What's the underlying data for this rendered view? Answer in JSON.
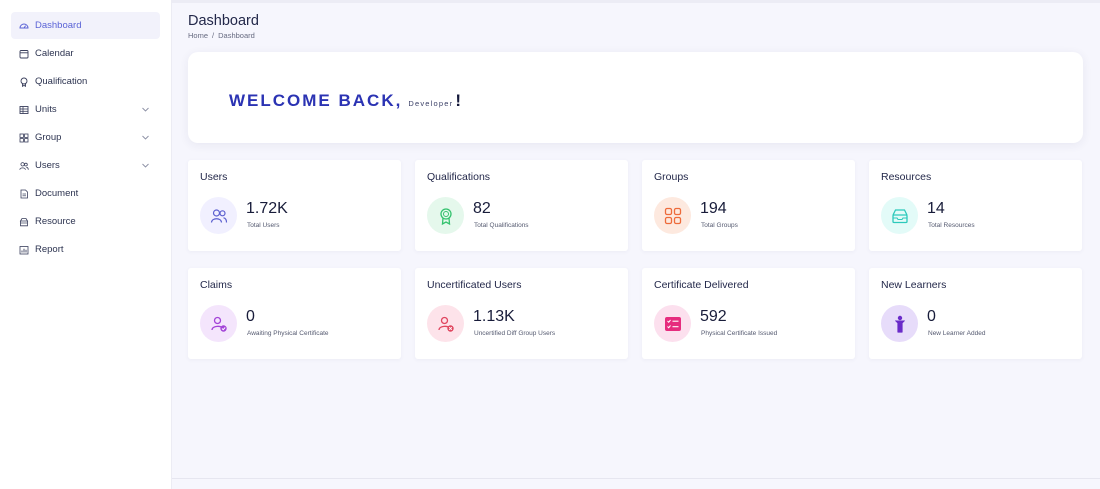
{
  "sidebar": {
    "items": [
      {
        "label": "Dashboard",
        "icon": "dashboard-icon",
        "active": true
      },
      {
        "label": "Calendar",
        "icon": "calendar-icon"
      },
      {
        "label": "Qualification",
        "icon": "qualification-icon"
      },
      {
        "label": "Units",
        "icon": "units-icon",
        "expandable": true
      },
      {
        "label": "Group",
        "icon": "group-icon",
        "expandable": true
      },
      {
        "label": "Users",
        "icon": "users-icon",
        "expandable": true
      },
      {
        "label": "Document",
        "icon": "document-icon"
      },
      {
        "label": "Resource",
        "icon": "resource-icon"
      },
      {
        "label": "Report",
        "icon": "report-icon"
      }
    ]
  },
  "header": {
    "title": "Dashboard",
    "breadcrumb": {
      "home": "Home",
      "separator": "/",
      "current": "Dashboard"
    }
  },
  "welcome": {
    "text": "WELCOME BACK,",
    "user": "Developer",
    "punctuation": "!"
  },
  "stats": [
    {
      "title": "Users",
      "value": "1.72K",
      "label": "Total Users",
      "icon": "users-icon",
      "bg": "#f1f0ff",
      "color": "#5b5fcf"
    },
    {
      "title": "Qualifications",
      "value": "82",
      "label": "Total Qualifications",
      "icon": "award-icon",
      "bg": "#e5f8ec",
      "color": "#34c26e"
    },
    {
      "title": "Groups",
      "value": "194",
      "label": "Total Groups",
      "icon": "grid-icon",
      "bg": "#fde9df",
      "color": "#ee6b3b"
    },
    {
      "title": "Resources",
      "value": "14",
      "label": "Total Resources",
      "icon": "inbox-icon",
      "bg": "#e3fbf8",
      "color": "#2cc9bb"
    },
    {
      "title": "Claims",
      "value": "0",
      "label": "Awaiting Physical Certificate",
      "icon": "user-check-icon",
      "bg": "#f4e5fc",
      "color": "#a344d8"
    },
    {
      "title": "Uncertificated Users",
      "value": "1.13K",
      "label": "Uncertified Diff Group Users",
      "icon": "user-x-icon",
      "bg": "#fde3ea",
      "color": "#e0465f"
    },
    {
      "title": "Certificate Delivered",
      "value": "592",
      "label": "Physical Certificate Issued",
      "icon": "checklist-icon",
      "bg": "#fce0ee",
      "color": "#e62c7e"
    },
    {
      "title": "New Learners",
      "value": "0",
      "label": "New Learner Added",
      "icon": "learner-icon",
      "bg": "#e7dcfa",
      "color": "#6a2bc9"
    }
  ]
}
